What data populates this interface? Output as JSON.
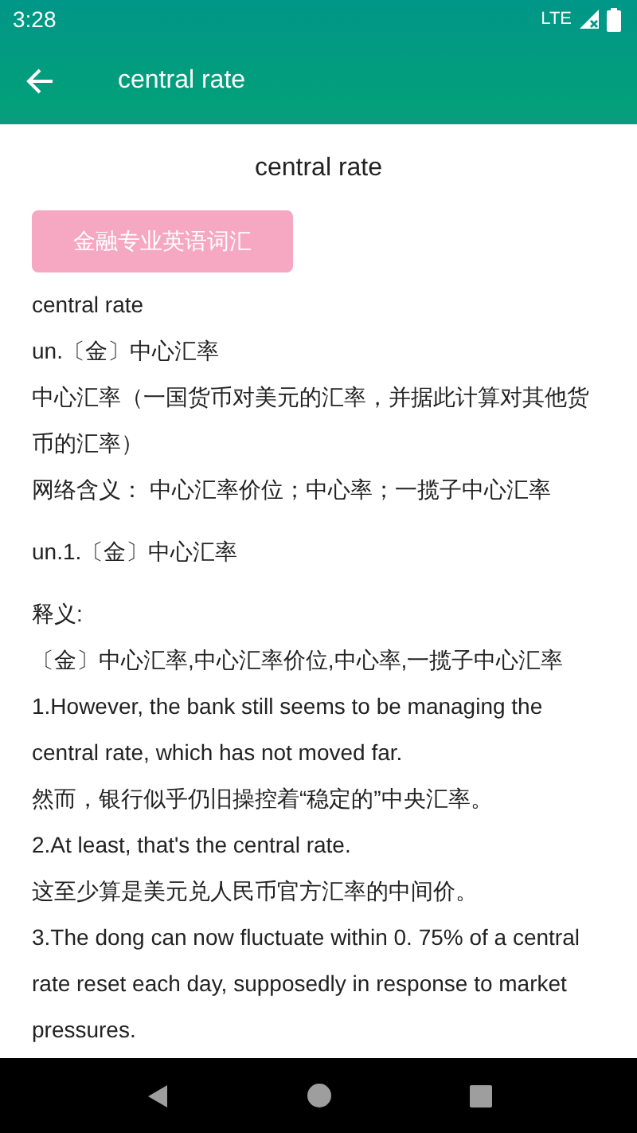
{
  "status_bar": {
    "time": "3:28",
    "network": "LTE"
  },
  "app_bar": {
    "title": "central rate"
  },
  "heading": "central rate",
  "category_button": "金融专业英语词汇",
  "lines": [
    {
      "kind": "line",
      "text": "central rate"
    },
    {
      "kind": "line",
      "text": "un.〔金〕中心汇率"
    },
    {
      "kind": "line",
      "text": "中心汇率（一国货币对美元的汇率，并据此计算对其他货币的汇率）"
    },
    {
      "kind": "line",
      "text": "网络含义： 中心汇率价位；中心率；一揽子中心汇率"
    },
    {
      "kind": "spaced",
      "text": "un.1.〔金〕中心汇率"
    },
    {
      "kind": "spaced",
      "text": "释义:"
    },
    {
      "kind": "line",
      "text": "〔金〕中心汇率,中心汇率价位,中心率,一揽子中心汇率"
    },
    {
      "kind": "line",
      "text": "1.However, the bank still seems to be managing the central rate, which has not moved far."
    },
    {
      "kind": "line",
      "text": "然而，银行似乎仍旧操控着“稳定的”中央汇率。"
    },
    {
      "kind": "line",
      "text": "2.At least, that's the central rate."
    },
    {
      "kind": "line",
      "text": "这至少算是美元兑人民币官方汇率的中间价。"
    },
    {
      "kind": "line",
      "text": "3.The dong can now fluctuate within 0. 75% of a central rate reset each day, supposedly in response to market pressures."
    }
  ]
}
